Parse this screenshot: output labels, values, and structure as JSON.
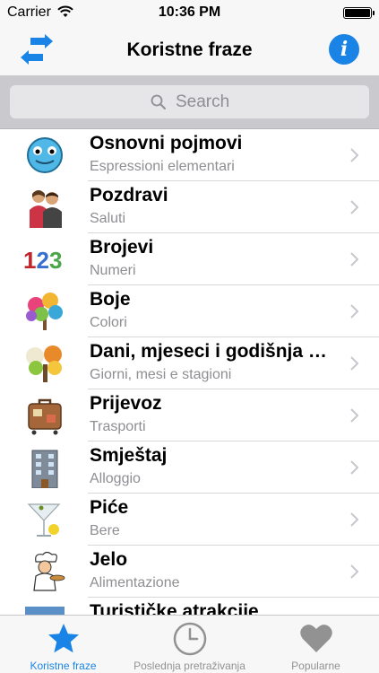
{
  "status_bar": {
    "carrier": "Carrier",
    "time": "10:36 PM"
  },
  "nav_bar": {
    "title": "Koristne fraze",
    "info_glyph": "i"
  },
  "search": {
    "placeholder": "Search"
  },
  "categories": [
    {
      "title": "Osnovni pojmovi",
      "subtitle": "Espressioni elementari",
      "icon": "smiley-icon"
    },
    {
      "title": "Pozdravi",
      "subtitle": "Saluti",
      "icon": "greeting-people-icon"
    },
    {
      "title": "Brojevi",
      "subtitle": "Numeri",
      "icon": "numbers-icon",
      "icon_text": "123"
    },
    {
      "title": "Boje",
      "subtitle": "Colori",
      "icon": "color-tree-icon"
    },
    {
      "title": "Dani, mjeseci i godišnja doba",
      "subtitle": "Giorni, mesi e stagioni",
      "icon": "seasons-tree-icon"
    },
    {
      "title": "Prijevoz",
      "subtitle": "Trasporti",
      "icon": "suitcase-icon"
    },
    {
      "title": "Smještaj",
      "subtitle": "Alloggio",
      "icon": "hotel-building-icon"
    },
    {
      "title": "Piće",
      "subtitle": "Bere",
      "icon": "cocktail-glass-icon"
    },
    {
      "title": "Jelo",
      "subtitle": "Alimentazione",
      "icon": "chef-icon"
    },
    {
      "title": "Turističke atrakcije",
      "subtitle": "",
      "icon": "attractions-icon"
    }
  ],
  "tabs": [
    {
      "label": "Koristne fraze",
      "icon": "star-icon",
      "active": true
    },
    {
      "label": "Poslednja pretraživanja",
      "icon": "clock-icon",
      "active": false
    },
    {
      "label": "Popularne",
      "icon": "heart-icon",
      "active": false
    }
  ],
  "colors": {
    "accent": "#1a84e6",
    "tab_inactive": "#929292",
    "search_bg": "#c9c9ce"
  }
}
